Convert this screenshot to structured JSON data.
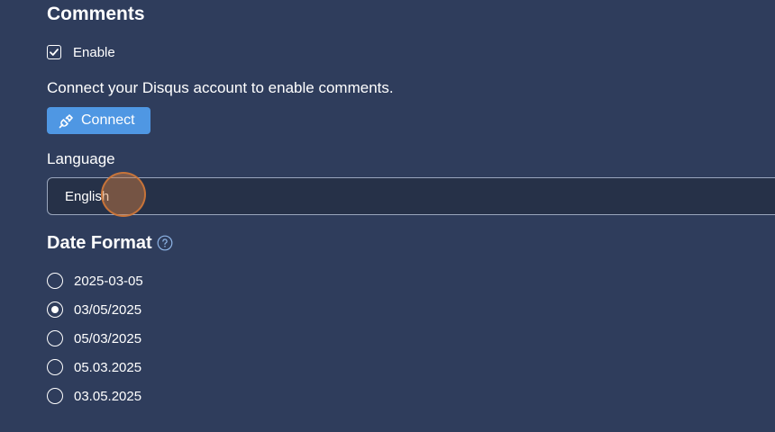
{
  "comments": {
    "title": "Comments",
    "enable_label": "Enable",
    "enable_checked": true,
    "description": "Connect your Disqus account to enable comments.",
    "connect_label": "Connect",
    "connect_icon": "plug-icon"
  },
  "language": {
    "label": "Language",
    "selected": "English"
  },
  "date_format": {
    "title": "Date Format",
    "help_icon": "question-circle-icon",
    "selected_index": 1,
    "options": [
      "2025-03-05",
      "03/05/2025",
      "05/03/2025",
      "05.03.2025",
      "03.05.2025"
    ]
  },
  "colors": {
    "background": "#2f3d5c",
    "accent": "#4f97e3",
    "select_background": "#263148"
  }
}
